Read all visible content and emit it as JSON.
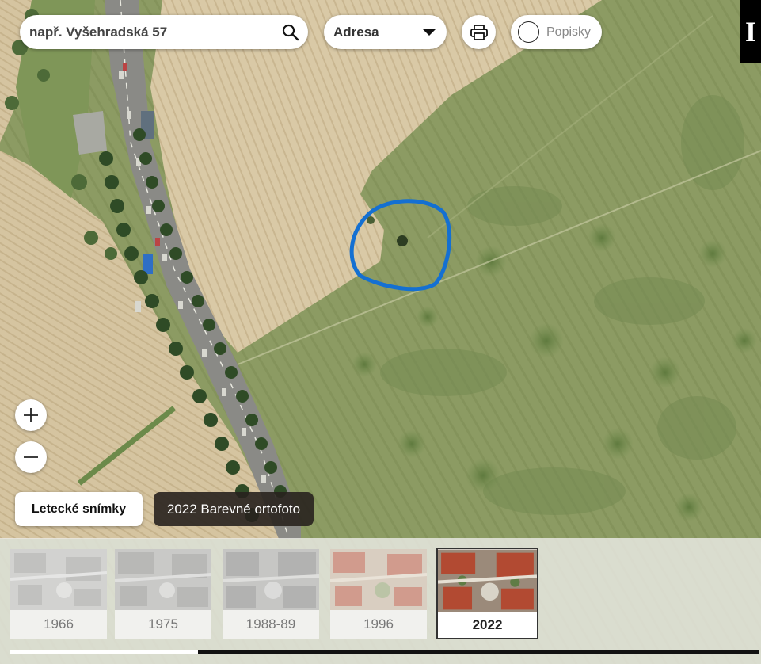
{
  "search": {
    "placeholder": "např. Vyšehradská 57",
    "icon": "search-icon"
  },
  "mode_select": {
    "selected": "Adresa"
  },
  "print": {
    "icon": "printer-icon"
  },
  "labels_toggle": {
    "label": "Popisky",
    "checked": false
  },
  "info": {
    "label": "I"
  },
  "zoom": {
    "in_label": "+",
    "out_label": "−"
  },
  "layers": {
    "button_label": "Letecké snímky",
    "tooltip": "2022 Barevné ortofoto"
  },
  "timeline": {
    "years": [
      "1966",
      "1975",
      "1988-89",
      "1996",
      "2022"
    ],
    "selected": "2022",
    "scroll_progress": 0.25
  },
  "colors": {
    "marker": "#1470d2",
    "field_green": "#8b9a62",
    "field_beige": "#d8c8a4",
    "tooltip_bg": "#28221e"
  }
}
